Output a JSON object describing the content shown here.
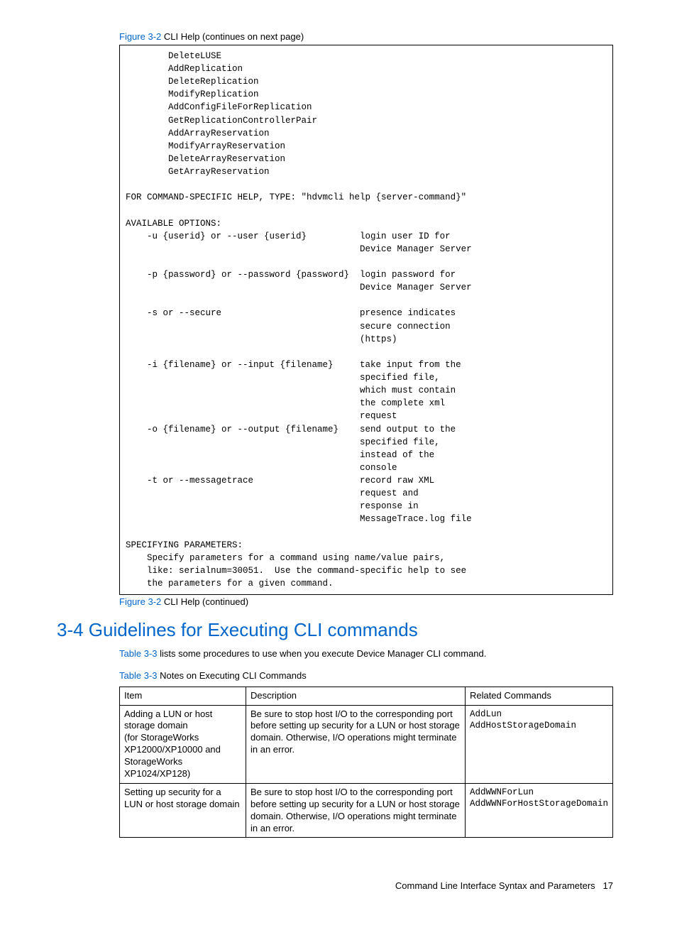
{
  "figure": {
    "top_link": "Figure 3-2",
    "top_text": " CLI Help (continues on next page)",
    "bottom_link": "Figure 3-2",
    "bottom_text": " CLI Help (continued)"
  },
  "cli": "        DeleteLUSE\n        AddReplication\n        DeleteReplication\n        ModifyReplication\n        AddConfigFileForReplication\n        GetReplicationControllerPair\n        AddArrayReservation\n        ModifyArrayReservation\n        DeleteArrayReservation\n        GetArrayReservation\n\nFOR COMMAND-SPECIFIC HELP, TYPE: \"hdvmcli help {server-command}\"\n\nAVAILABLE OPTIONS:\n    -u {userid} or --user {userid}          login user ID for\n                                            Device Manager Server\n\n    -p {password} or --password {password}  login password for\n                                            Device Manager Server\n\n    -s or --secure                          presence indicates\n                                            secure connection\n                                            (https)\n\n    -i {filename} or --input {filename}     take input from the\n                                            specified file,\n                                            which must contain\n                                            the complete xml\n                                            request\n    -o {filename} or --output {filename}    send output to the\n                                            specified file,\n                                            instead of the\n                                            console\n    -t or --messagetrace                    record raw XML\n                                            request and\n                                            response in\n                                            MessageTrace.log file\n\nSPECIFYING PARAMETERS:\n    Specify parameters for a command using name/value pairs,\n    like: serialnum=30051.  Use the command-specific help to see\n    the parameters for a given command.",
  "section_heading": "3-4 Guidelines for Executing CLI commands",
  "intro": {
    "link": "Table 3-3",
    "rest": " lists some procedures to use when you execute Device Manager CLI command."
  },
  "table_caption": {
    "link": "Table 3-3",
    "rest": "  Notes on Executing CLI Commands"
  },
  "table": {
    "headers": {
      "c1": "Item",
      "c2": "Description",
      "c3": "Related Commands"
    },
    "rows": [
      {
        "item": "Adding a LUN or host storage domain\n(for StorageWorks XP12000/XP10000 and StorageWorks XP1024/XP128)",
        "desc": "Be sure to stop host I/O to the corresponding port before setting up security for a LUN or host storage domain. Otherwise, I/O operations might terminate in an error.",
        "cmds": "AddLun\nAddHostStorageDomain"
      },
      {
        "item": "Setting up security for a LUN or host storage domain",
        "desc": "Be sure to stop host I/O to the corresponding port before setting up security for a LUN or host storage domain. Otherwise, I/O operations might terminate in an error.",
        "cmds": "AddWWNForLun\nAddWWNForHostStorageDomain"
      }
    ]
  },
  "footer": {
    "title": "Command Line Interface Syntax and Parameters",
    "page": "17"
  }
}
